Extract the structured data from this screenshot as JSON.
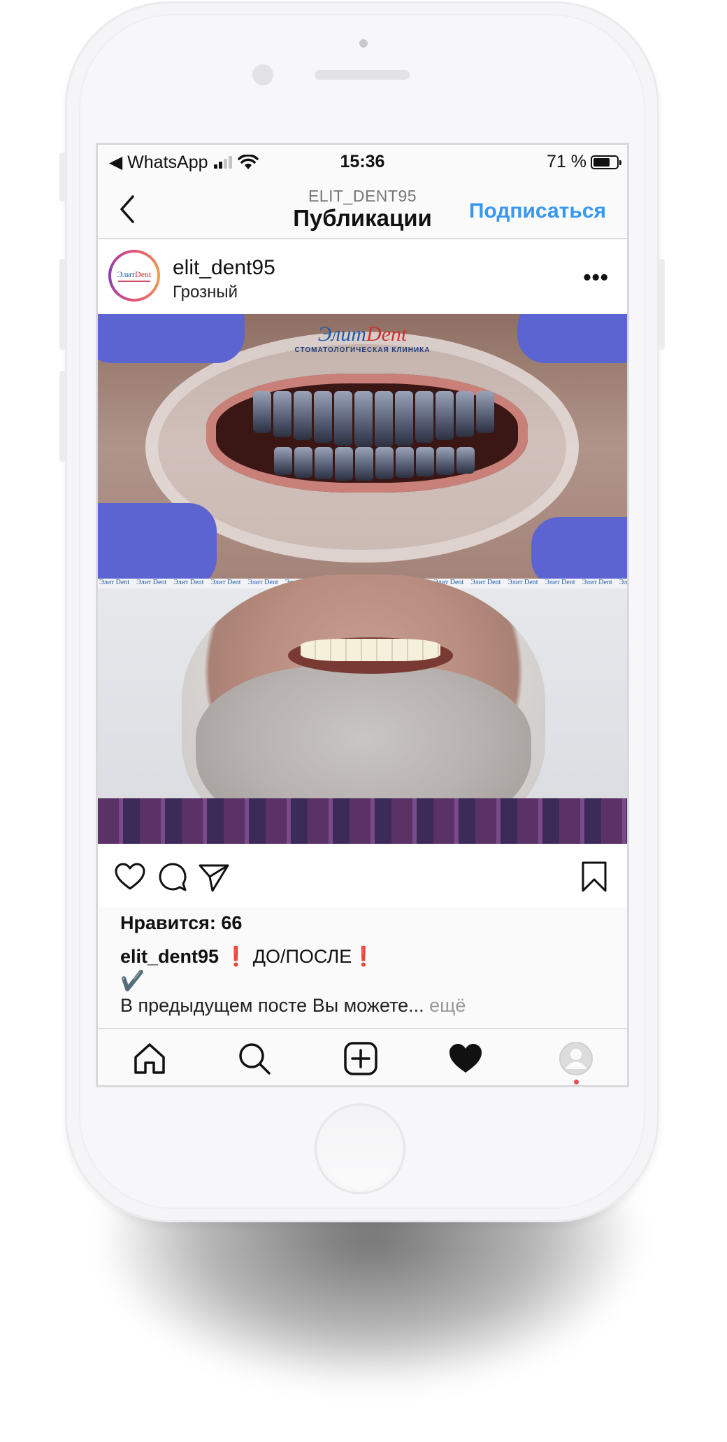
{
  "status_bar": {
    "back_app": "◀ WhatsApp",
    "time": "15:36",
    "battery_text": "71 %",
    "battery_level": 0.71
  },
  "nav": {
    "subtitle": "ELIT_DENT95",
    "title": "Публикации",
    "follow_label": "Подписаться"
  },
  "post": {
    "username": "elit_dent95",
    "location": "Грозный",
    "more_glyph": "•••",
    "avatar_brand_left": "Элит",
    "avatar_brand_right": "Dent",
    "photo": {
      "watermark_left": "Элит",
      "watermark_right": "Dent",
      "watermark_sub": "СТОМАТОЛОГИЧЕСКАЯ КЛИНИКА",
      "strip_label": "Элит Dent"
    },
    "likes": "Нравится: 66",
    "caption_user": "elit_dent95",
    "caption_mark_1": "❗",
    "caption_text": " ДО/ПОСЛЕ",
    "caption_mark_2": "❗",
    "caption_check": "✔️",
    "caption_line2": "В предыдущем посте Вы можете...",
    "more_link": " ещё"
  },
  "icons": {
    "like": "heart-outline",
    "comment": "comment-bubble",
    "share": "paper-plane",
    "save": "bookmark",
    "home": "home",
    "search": "magnifier",
    "add": "plus-square",
    "activity": "heart-filled",
    "profile": "user-circle"
  },
  "colors": {
    "follow": "#3897f0",
    "notification_dot": "#ed4956",
    "mark": "#e0202a"
  }
}
